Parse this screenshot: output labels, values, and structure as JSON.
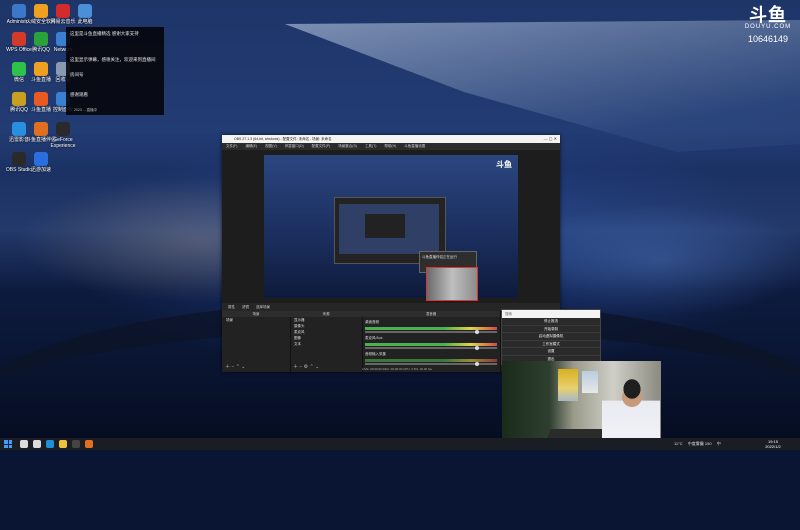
{
  "desktop": {
    "icons": [
      {
        "label": "Administr...",
        "color": "#3b78c8"
      },
      {
        "label": "火绒安全软件",
        "color": "#f0a020"
      },
      {
        "label": "网易云音乐",
        "color": "#d12b2b"
      },
      {
        "label": "此电脑",
        "color": "#4a8fd8"
      },
      {
        "label": "WPS Office",
        "color": "#d23a2a"
      },
      {
        "label": "腾讯QQ",
        "color": "#2aa23a"
      },
      {
        "label": "Network",
        "color": "#3a7fd0"
      },
      {
        "label": "微信",
        "color": "#2fc24a"
      },
      {
        "label": "斗鱼直播",
        "color": "#f0a020"
      },
      {
        "label": "回收站",
        "color": "#8a9ab0"
      },
      {
        "label": "腾讯QQ",
        "color": "#c8a020"
      },
      {
        "label": "斗鱼直播",
        "color": "#e85a20"
      },
      {
        "label": "控制面板",
        "color": "#3a7fd0"
      },
      {
        "label": "迅雷影音",
        "color": "#2a8fe0"
      },
      {
        "label": "斗鱼直播伴侣",
        "color": "#e07020"
      },
      {
        "label": "GeForce Experience",
        "color": "#2a2a2a"
      },
      {
        "label": "OBS Studio",
        "color": "#2a2a2a"
      },
      {
        "label": "迅游加速",
        "color": "#2a6fe0"
      }
    ]
  },
  "notifications": [
    "这里是斗鱼直播精选 感谢大家支持",
    "这里显示弹幕，感谢关注，欢迎来到直播间",
    "房间号",
    "感谢观看"
  ],
  "notification_status": "2023 ... 直播中",
  "douyu": {
    "glyph": "斗鱼",
    "brand": "DOUYU.COM",
    "room_id": "10646149"
  },
  "obs": {
    "title": "OBS 27.1.3 (64-bit, windows) - 配置文件: 未命名 - 场景: 未命名",
    "menu": [
      "文件(F)",
      "编辑(E)",
      "视图(V)",
      "停靠窗口(D)",
      "配置文件(P)",
      "场景集合(S)",
      "工具(T)",
      "帮助(H)",
      "斗鱼直播设置"
    ],
    "popup_text": "斗鱼直播伴侣正在运行",
    "dock_tabs": [
      "属性",
      "滤镜",
      "选择场景"
    ],
    "scenes_header": "场景",
    "scenes": [
      "场景"
    ],
    "sources_header": "来源",
    "sources": [
      "显示器",
      "摄像头",
      "麦克风",
      "图像",
      "文本"
    ],
    "mixer_header": "混音器",
    "mixer_channels": [
      {
        "name": "桌面音频",
        "db": "0.0 dB"
      },
      {
        "name": "麦克风/Aux",
        "db": "0.0 dB"
      },
      {
        "name": "音频输入采集",
        "db": "0.0 dB"
      }
    ],
    "status": "LIVE: 00:00:00  REC: 00:00:00  CPU: 3.5%, 30.00 fps"
  },
  "context_menu": {
    "search_placeholder": "搜索",
    "items": [
      "停止推流",
      "开始录制",
      "启动虚拟摄像机",
      "工作室模式",
      "设置",
      "退出"
    ]
  },
  "taskbar": {
    "apps": [
      {
        "name": "search-icon",
        "color": "#dddddd"
      },
      {
        "name": "task-view-icon",
        "color": "#dddddd"
      },
      {
        "name": "edge-icon",
        "color": "#1e90d8"
      },
      {
        "name": "explorer-icon",
        "color": "#f0c040"
      },
      {
        "name": "obs-icon",
        "color": "#444444"
      },
      {
        "name": "douyu-icon",
        "color": "#e07020"
      }
    ],
    "weather": "11°C",
    "tray_text": "中度雾霾 150",
    "ime": "中",
    "time": "19:15",
    "date": "2022/1/2"
  }
}
